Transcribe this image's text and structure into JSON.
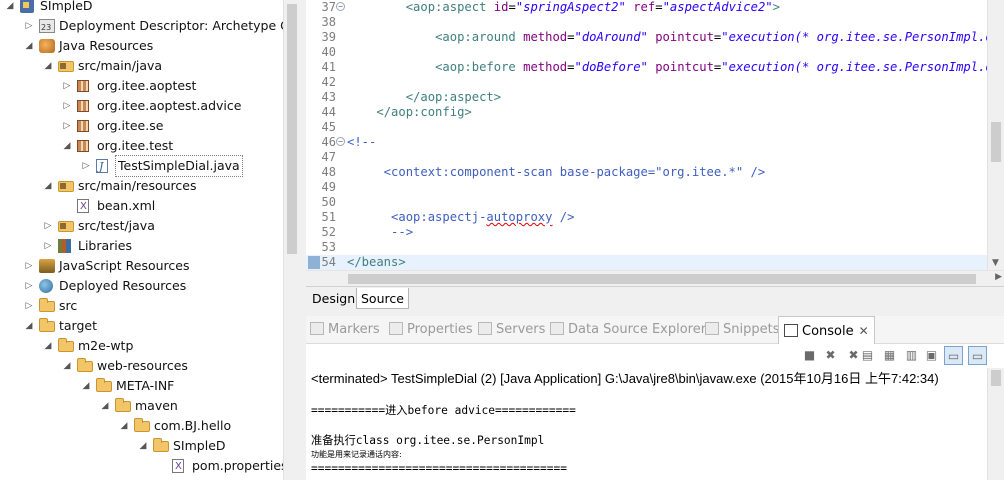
{
  "explorer": {
    "rows": [
      {
        "label": "SImpleD",
        "icon": "project-icon",
        "depth": 0,
        "expanded": true,
        "name": "tree-project-simpled"
      },
      {
        "label": "Deployment Descriptor: Archetype Crea",
        "icon": "deployment-descriptor-icon",
        "depth": 1,
        "expanded": false,
        "name": "tree-deployment-descriptor"
      },
      {
        "label": "Java Resources",
        "icon": "java-resources-icon",
        "depth": 1,
        "expanded": true,
        "name": "tree-java-resources"
      },
      {
        "label": "src/main/java",
        "icon": "source-folder-icon",
        "depth": 2,
        "expanded": true,
        "name": "tree-src-main-java"
      },
      {
        "label": "org.itee.aoptest",
        "icon": "package-icon",
        "depth": 3,
        "expanded": false,
        "name": "tree-pkg-aoptest"
      },
      {
        "label": "org.itee.aoptest.advice",
        "icon": "package-icon",
        "depth": 3,
        "expanded": false,
        "name": "tree-pkg-aoptest-advice"
      },
      {
        "label": "org.itee.se",
        "icon": "package-icon",
        "depth": 3,
        "expanded": false,
        "name": "tree-pkg-se"
      },
      {
        "label": "org.itee.test",
        "icon": "package-icon",
        "depth": 3,
        "expanded": true,
        "name": "tree-pkg-test"
      },
      {
        "label": "TestSimpleDial.java",
        "icon": "java-file-icon",
        "depth": 4,
        "expanded": false,
        "selected": true,
        "name": "tree-file-testsimpledial"
      },
      {
        "label": "src/main/resources",
        "icon": "source-folder-icon",
        "depth": 2,
        "expanded": true,
        "name": "tree-src-main-resources"
      },
      {
        "label": "bean.xml",
        "icon": "xml-file-icon",
        "depth": 3,
        "leaf": true,
        "name": "tree-file-bean-xml"
      },
      {
        "label": "src/test/java",
        "icon": "source-folder-icon",
        "depth": 2,
        "expanded": false,
        "name": "tree-src-test-java"
      },
      {
        "label": "Libraries",
        "icon": "libraries-icon",
        "depth": 2,
        "expanded": false,
        "name": "tree-libraries"
      },
      {
        "label": "JavaScript Resources",
        "icon": "javascript-resources-icon",
        "depth": 1,
        "expanded": false,
        "name": "tree-javascript-resources"
      },
      {
        "label": "Deployed Resources",
        "icon": "deployed-resources-icon",
        "depth": 1,
        "expanded": false,
        "name": "tree-deployed-resources"
      },
      {
        "label": "src",
        "icon": "folder-icon",
        "depth": 1,
        "expanded": false,
        "name": "tree-folder-src"
      },
      {
        "label": "target",
        "icon": "folder-icon",
        "depth": 1,
        "expanded": true,
        "name": "tree-folder-target"
      },
      {
        "label": "m2e-wtp",
        "icon": "folder-icon",
        "depth": 2,
        "expanded": true,
        "name": "tree-folder-m2e-wtp"
      },
      {
        "label": "web-resources",
        "icon": "folder-icon",
        "depth": 3,
        "expanded": true,
        "name": "tree-folder-web-resources"
      },
      {
        "label": "META-INF",
        "icon": "folder-icon",
        "depth": 4,
        "expanded": true,
        "name": "tree-folder-meta-inf"
      },
      {
        "label": "maven",
        "icon": "folder-icon",
        "depth": 5,
        "expanded": true,
        "name": "tree-folder-maven"
      },
      {
        "label": "com.BJ.hello",
        "icon": "folder-icon",
        "depth": 6,
        "expanded": true,
        "name": "tree-folder-com-bj-hello"
      },
      {
        "label": "SImpleD",
        "icon": "folder-icon",
        "depth": 7,
        "expanded": true,
        "name": "tree-folder-simpled"
      },
      {
        "label": "pom.properties",
        "icon": "file-icon",
        "depth": 8,
        "leaf": true,
        "name": "tree-file-pom-properties"
      }
    ]
  },
  "editor": {
    "lines": [
      {
        "num": "37",
        "fold": "−",
        "html": "        <span class=\"tag\">&lt;aop:aspect</span> <span class=\"attr\">id</span>=<span class=\"val\">\"springAspect2\"</span> <span class=\"attr\">ref</span>=<span class=\"val\">\"aspectAdvice2\"</span><span class=\"tag\">&gt;</span>"
      },
      {
        "num": "38",
        "html": ""
      },
      {
        "num": "39",
        "html": "            <span class=\"tag\">&lt;aop:around</span> <span class=\"attr\">method</span>=<span class=\"val\">\"doAround\"</span> <span class=\"attr\">pointcut</span>=<span class=\"val\">\"execution(* org.itee.se.PersonImpl.dial(</span>"
      },
      {
        "num": "40",
        "html": ""
      },
      {
        "num": "41",
        "html": "            <span class=\"tag\">&lt;aop:before</span> <span class=\"attr\">method</span>=<span class=\"val\">\"doBefore\"</span> <span class=\"attr\">pointcut</span>=<span class=\"val\">\"execution(* org.itee.se.PersonImpl.dial(</span>"
      },
      {
        "num": "42",
        "html": ""
      },
      {
        "num": "43",
        "html": "        <span class=\"tag\">&lt;/aop:aspect&gt;</span>"
      },
      {
        "num": "44",
        "html": "    <span class=\"tag\">&lt;/aop:config&gt;</span>"
      },
      {
        "num": "45",
        "html": ""
      },
      {
        "num": "46",
        "fold": "−",
        "html": "<span class=\"cmt\">&lt;!--</span>"
      },
      {
        "num": "47",
        "html": ""
      },
      {
        "num": "48",
        "html": "<span class=\"cmt\">     &lt;context:component-scan base-package=\"org.itee.*\" /&gt;</span>"
      },
      {
        "num": "49",
        "html": ""
      },
      {
        "num": "50",
        "html": ""
      },
      {
        "num": "51",
        "html": "<span class=\"cmt\">      &lt;aop:aspectj-<span class=\"squig\">autoproxy</span> /&gt;</span>"
      },
      {
        "num": "52",
        "html": "<span class=\"cmt\">      --&gt;</span>"
      },
      {
        "num": "53",
        "html": ""
      },
      {
        "num": "54",
        "html": "<span class=\"tag\">&lt;/beans&gt;</span>",
        "current": true
      }
    ],
    "tabs": {
      "design": "Design",
      "source": "Source"
    }
  },
  "views": {
    "tabs": [
      {
        "label": "Markers",
        "name": "tab-markers",
        "icon": "markers-icon"
      },
      {
        "label": "Properties",
        "name": "tab-properties",
        "icon": "properties-icon"
      },
      {
        "label": "Servers",
        "name": "tab-servers",
        "icon": "servers-icon"
      },
      {
        "label": "Data Source Explorer",
        "name": "tab-data-source-explorer",
        "icon": "data-source-icon"
      },
      {
        "label": "Snippets",
        "name": "tab-snippets",
        "icon": "snippets-icon"
      },
      {
        "label": "Console",
        "name": "tab-console",
        "icon": "console-icon",
        "active": true,
        "close": "✕"
      }
    ]
  },
  "console": {
    "toolbar": [
      {
        "name": "terminate-button",
        "glyph": "■"
      },
      {
        "name": "remove-launch-button",
        "glyph": "✖"
      },
      {
        "name": "remove-all-terminated-button",
        "glyph": "✖"
      },
      {
        "name": "clear-console-button",
        "glyph": "▤"
      },
      {
        "name": "scroll-lock-button",
        "glyph": "▦"
      },
      {
        "name": "word-wrap-button",
        "glyph": "▥"
      },
      {
        "name": "pin-console-button",
        "glyph": "▣"
      },
      {
        "name": "display-selected-console-button",
        "glyph": "▭",
        "pressed": true
      },
      {
        "name": "open-console-button",
        "glyph": "▭",
        "pressed": true
      }
    ],
    "header": "<terminated> TestSimpleDial (2) [Java Application] G:\\Java\\jre8\\bin\\javaw.exe (2015年10月16日 上午7:42:34)",
    "line1": "===========进入before advice============",
    "line2": "准备执行class org.itee.se.PersonImpl",
    "line3": "功能是用来记录通话内容:",
    "line4": "======================================"
  }
}
